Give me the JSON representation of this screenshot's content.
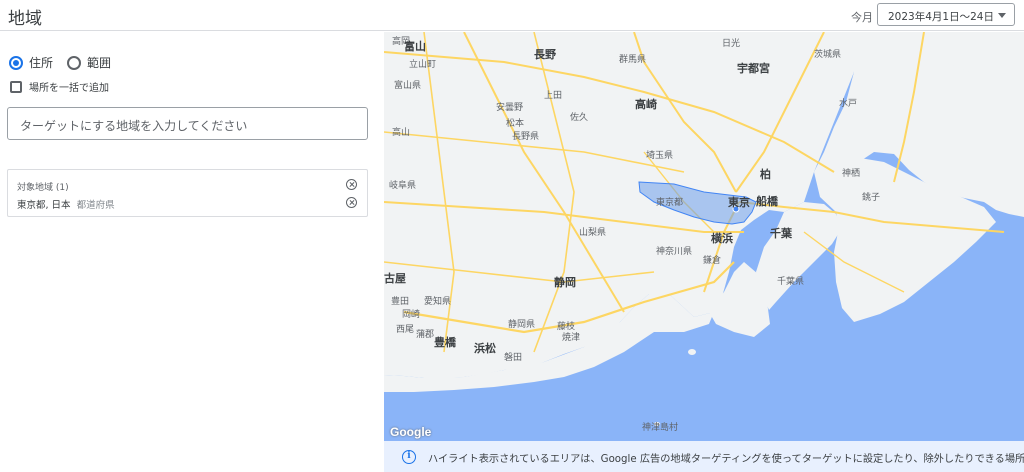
{
  "header": {
    "title": "地域",
    "date_label": "今月",
    "date_range": "2023年4月1日～24日"
  },
  "left_panel": {
    "radio_address": "住所",
    "radio_radius": "範囲",
    "bulk_add_label": "場所を一括で追加",
    "search_placeholder": "ターゲットにする地域を入力してください",
    "target_header": "対象地域 (1)",
    "target_location": "東京都, 日本",
    "target_location_type": "都道府県"
  },
  "map": {
    "place_labels": [
      "高岡",
      "富山",
      "立山町",
      "富山県",
      "長野",
      "上田",
      "群馬県",
      "日光",
      "宇都宮",
      "茨城県",
      "安曇野",
      "松本",
      "長野県",
      "佐久",
      "高崎",
      "岐阜県",
      "埼玉県",
      "柏",
      "神栖",
      "銚子",
      "東京都",
      "東京",
      "船橋",
      "千葉",
      "横浜",
      "山梨県",
      "神奈川県",
      "鎌倉",
      "千葉県",
      "古屋",
      "豊田",
      "愛知県",
      "岡崎",
      "静岡",
      "静岡県",
      "藤枝",
      "焼津",
      "西尾",
      "蒲郡",
      "豊橋",
      "浜松",
      "磐田",
      "神津島村",
      "高山",
      "水戸"
    ],
    "google_logo": "Google"
  },
  "info_bar": {
    "icon": "info-icon",
    "text": "ハイライト表示されているエリアは、Google 広告の地域ターゲティングを使ってターゲットに設定したり、除外したりできる場所です。"
  },
  "colors": {
    "accent": "#1a73e8",
    "sea": "#8ab4f8",
    "land": "#f1f3f4",
    "highway": "#fdd663",
    "highlight": "#6d9eeb"
  }
}
